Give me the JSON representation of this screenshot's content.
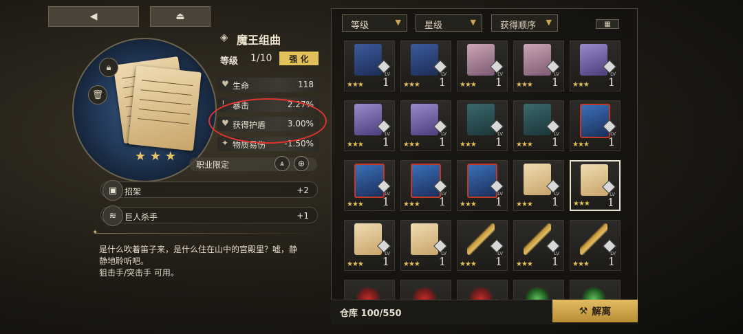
{
  "nav": {
    "back_icon": "back-arrow-icon",
    "eject_icon": "eject-icon"
  },
  "item": {
    "name": "魔王组曲",
    "level_label": "等级",
    "level_value": "1/10",
    "enhance_label": "强 化",
    "stars": "★ ★ ★",
    "class_restrict_label": "职业限定"
  },
  "stats": [
    {
      "label": "生命",
      "value": "118"
    },
    {
      "label": "暴击",
      "value": "2.27%"
    },
    {
      "label": "获得护盾",
      "value": "3.00%"
    },
    {
      "label": "物质易伤",
      "value": "-1.50%"
    }
  ],
  "skills": [
    {
      "label": "招架",
      "value": "+2"
    },
    {
      "label": "巨人杀手",
      "value": "+1"
    }
  ],
  "description": {
    "line1": "是什么吹着笛子来，是什么住在山中的宫殿里？嘘，静",
    "line2": "静地聆听吧。",
    "line3": "狙击手/突击手 可用。"
  },
  "filters": {
    "level": "等级",
    "stars": "星级",
    "order": "获得顺序"
  },
  "grid": {
    "lv_label": "LV",
    "num": "1",
    "stars": "★★★",
    "rows": [
      [
        {
          "kind": "card-blue"
        },
        {
          "kind": "card-blue"
        },
        {
          "kind": "card-pink"
        },
        {
          "kind": "card-pink"
        },
        {
          "kind": "card-purple"
        }
      ],
      [
        {
          "kind": "card-purple"
        },
        {
          "kind": "card-purple"
        },
        {
          "kind": "card-green"
        },
        {
          "kind": "card-green"
        },
        {
          "kind": "card-red"
        }
      ],
      [
        {
          "kind": "card-red"
        },
        {
          "kind": "card-red"
        },
        {
          "kind": "card-red"
        },
        {
          "kind": "paper"
        },
        {
          "kind": "paper",
          "selected": true
        }
      ],
      [
        {
          "kind": "paper"
        },
        {
          "kind": "paper"
        },
        {
          "kind": "key"
        },
        {
          "kind": "key"
        },
        {
          "kind": "key"
        }
      ],
      [
        {
          "kind": "gem-red"
        },
        {
          "kind": "gem-red"
        },
        {
          "kind": "gem-red"
        },
        {
          "kind": "gem-green"
        },
        {
          "kind": "gem-green"
        }
      ]
    ]
  },
  "storage": {
    "label": "仓库 100/550"
  },
  "dismantle": {
    "label": "解离"
  },
  "colors": {
    "accent": "#e2bc63",
    "highlight_circle": "#e0332e"
  }
}
